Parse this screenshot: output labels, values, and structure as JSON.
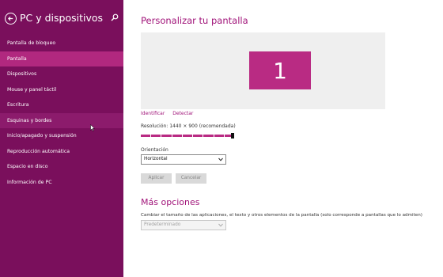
{
  "sidebar": {
    "title": "PC y dispositivos",
    "back_icon": "back-arrow-icon",
    "search_icon": "search-icon",
    "items": [
      {
        "label": "Pantalla de bloqueo"
      },
      {
        "label": "Pantalla"
      },
      {
        "label": "Dispositivos"
      },
      {
        "label": "Mouse y panel táctil"
      },
      {
        "label": "Escritura"
      },
      {
        "label": "Esquinas y bordes"
      },
      {
        "label": "Inicio/apagado y suspensión"
      },
      {
        "label": "Reproducción automática"
      },
      {
        "label": "Espacio en disco"
      },
      {
        "label": "Información de PC"
      }
    ],
    "selected_item": "Pantalla",
    "hovered_item": "Esquinas y bordes"
  },
  "main": {
    "title": "Personalizar tu pantalla",
    "monitor_number": "1",
    "identify_link": "Identificar",
    "detect_link": "Detectar",
    "resolution_label": "Resolución: 1440 × 900 (recomendada)",
    "resolution_slider_value": 1.0,
    "orientation_label": "Orientación",
    "orientation_value": "Horizontal",
    "apply_button": "Aplicar",
    "cancel_button": "Cancelar",
    "more_options_title": "Más opciones",
    "scaling_description": "Cambiar el tamaño de las aplicaciones, el texto y otros elementos de la pantalla (solo corresponde a pantallas que lo admiten)",
    "scaling_value": "Predeterminado"
  },
  "colors": {
    "sidebar_bg": "#7a0f5c",
    "selected_bg": "#b1287f",
    "accent": "#a1157a",
    "monitor_tile": "#b92b83"
  }
}
